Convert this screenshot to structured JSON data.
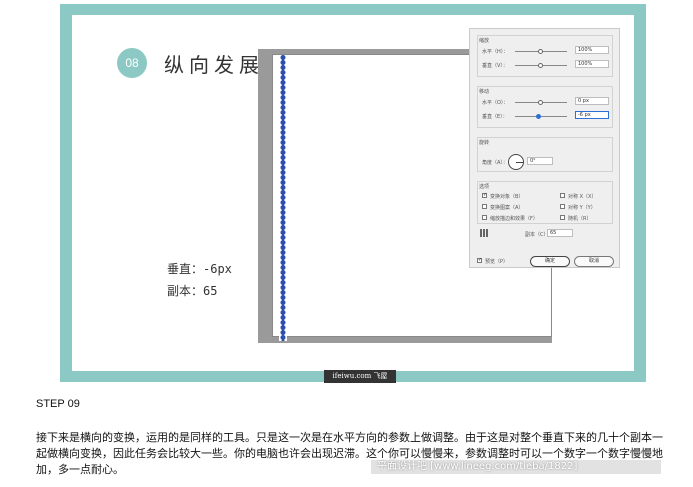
{
  "slide": {
    "step_number": "08",
    "title": "纵向发展",
    "params": {
      "vertical": "垂直：-6px",
      "copies": "副本：65"
    },
    "watermark": "ifeiwu.com 飞屋"
  },
  "dialog": {
    "scale_group": {
      "title": "缩放",
      "horizontal_label": "水平（H）：",
      "horizontal_value": "100%",
      "vertical_label": "垂直（V）：",
      "vertical_value": "100%"
    },
    "move_group": {
      "title": "移动",
      "horizontal_label": "水平（O）：",
      "horizontal_value": "0 px",
      "vertical_label": "垂直（E）：",
      "vertical_value": "-6 px"
    },
    "rotate_group": {
      "title": "旋转",
      "angle_label": "角度（A）：",
      "angle_value": "0°"
    },
    "options_group": {
      "title": "选项",
      "transform_objects": {
        "label": "变换对象（B）",
        "checked": true
      },
      "transform_patterns": {
        "label": "变换图案（A）",
        "checked": false
      },
      "scale_strokes": {
        "label": "缩放描边和效果（F）",
        "checked": false
      },
      "reflect_x": {
        "label": "对称 X（X）",
        "checked": false
      },
      "reflect_y": {
        "label": "对称 Y（Y）",
        "checked": false
      },
      "random": {
        "label": "随机（R）",
        "checked": false
      }
    },
    "copies_label": "副本（C）",
    "copies_value": "65",
    "preview": {
      "label": "预览（P）",
      "checked": true
    },
    "ok_label": "确定",
    "cancel_label": "取消"
  },
  "article": {
    "step_heading": "STEP 09",
    "body": "接下来是横向的变换，运用的是同样的工具。只是这一次是在水平方向的参数上做调整。由于这是对整个垂直下来的几十个副本一起做横向变换，因此任务会比较大一些。你的电脑也许会出现迟滞。这个你可以慢慢来，参数调整时可以一个数字一个数字慢慢地加，多一点耐心。",
    "source_watermark": "平面设计吧  [www.lineeg.com/tieba/1822]"
  },
  "colors": {
    "frame_teal": "#8cc8c4",
    "bead_blue": "#2c4fb0",
    "focus_blue": "#2d6fd6"
  }
}
